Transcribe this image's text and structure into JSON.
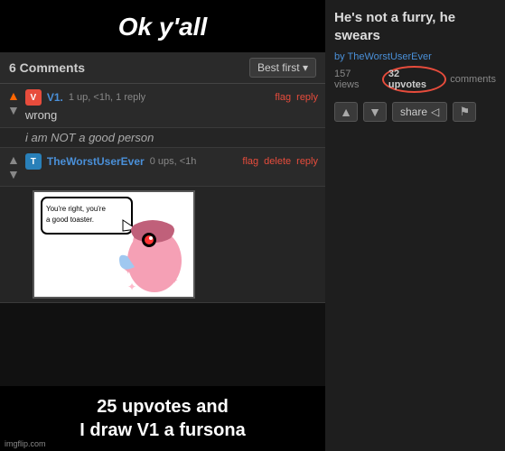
{
  "left": {
    "meme_top_text": "Ok y'all",
    "meme_bottom_text": "25 upvotes and\nI draw V1 a fursona",
    "speech_bubble_text": "You're right, you're a good toaster.",
    "comments_count": "6 Comments",
    "sort_label": "Best first ▾",
    "imgflip_watermark": "imgflip.com",
    "comments": [
      {
        "username": "V1.",
        "stats": "1 up, <1h, 1 reply",
        "text": "wrong",
        "actions": [
          "flag",
          "reply"
        ],
        "avatar_color": "red",
        "avatar_letter": "V",
        "upvoted": true
      },
      {
        "username": "TheWorstUserEver",
        "stats": "0 ups, <1h",
        "text": "i am NOT a good person",
        "actions": [
          "flag",
          "delete",
          "reply"
        ],
        "avatar_color": "blue",
        "avatar_letter": "T",
        "upvoted": false
      }
    ]
  },
  "right": {
    "post_title": "He's not a furry, he swears",
    "by_label": "by",
    "author": "TheWorstUserEver",
    "views": "157 views",
    "upvotes": "32 upvotes",
    "comments_label": "comments",
    "share_label": "share",
    "share_icon": "◁",
    "flag_icon": "⚑",
    "up_arrow": "▲",
    "down_arrow": "▼"
  }
}
